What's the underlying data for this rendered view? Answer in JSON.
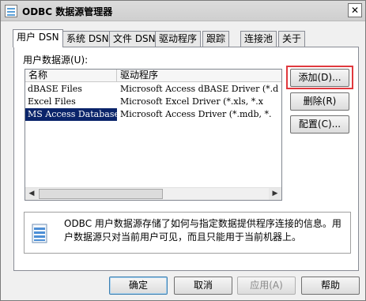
{
  "window": {
    "title": "ODBC 数据源管理器",
    "close_glyph": "✕"
  },
  "tabs": [
    {
      "label": "用户 DSN"
    },
    {
      "label": "系统 DSN"
    },
    {
      "label": "文件 DSN"
    },
    {
      "label": "驱动程序"
    },
    {
      "label": "跟踪"
    },
    {
      "label": "连接池"
    },
    {
      "label": "关于"
    }
  ],
  "user_dsn": {
    "section_label": "用户数据源(U):",
    "columns": [
      "名称",
      "驱动程序"
    ],
    "rows": [
      {
        "name": "dBASE Files",
        "driver": "Microsoft Access dBASE Driver (*.d"
      },
      {
        "name": "Excel Files",
        "driver": "Microsoft Excel Driver (*.xls, *.x"
      },
      {
        "name": "MS Access Database",
        "driver": "Microsoft Access Driver (*.mdb, *."
      }
    ],
    "selected_row": 2,
    "scroll": {
      "left_glyph": "◀",
      "right_glyph": "▶"
    }
  },
  "side_buttons": {
    "add": "添加(D)...",
    "remove": "删除(R)",
    "configure": "配置(C)..."
  },
  "info": {
    "text": "ODBC 用户数据源存储了如何与指定数据提供程序连接的信息。用户数据源只对当前用户可见，而且只能用于当前机器上。"
  },
  "footer": {
    "ok": "确定",
    "cancel": "取消",
    "apply": "应用(A)",
    "help": "帮助"
  },
  "colors": {
    "selection": "#0a246a",
    "highlight": "#e0393e"
  }
}
